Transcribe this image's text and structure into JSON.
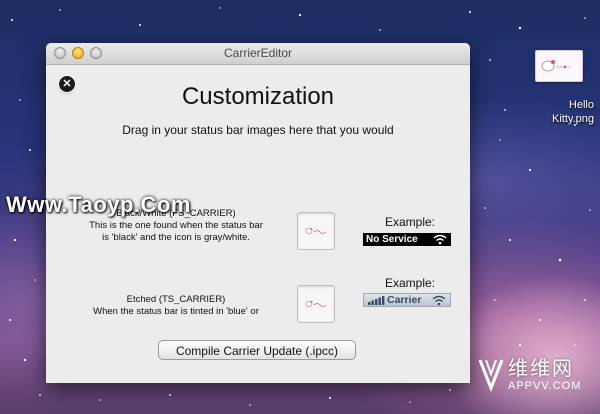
{
  "window": {
    "title": "CarrierEditor",
    "close_glyph": "✕"
  },
  "main": {
    "heading": "Customization",
    "instruction": "Drag in your status bar images here that you would",
    "sections": [
      {
        "desc_line1": "Black/White (FS_CARRIER)",
        "desc_line2": "This is the one found when the status bar",
        "desc_line3": "is 'black' and the icon is gray/white.",
        "example_label": "Example:",
        "example_text": "No Service"
      },
      {
        "desc_line1": "Etched (TS_CARRIER)",
        "desc_line2": "When the status bar is tinted in 'blue' or",
        "example_label": "Example:",
        "example_text": "Carrier"
      }
    ],
    "compile_button": "Compile Carrier Update (.ipcc)"
  },
  "desktop": {
    "file_label": "Hello\nKitty.png",
    "file_icon": "hello-kitty-image-thumbnail"
  },
  "overlays": {
    "watermark_text": "Www.Taoyp.Com",
    "brand_cn": "维维网",
    "brand_url": "APPVV.COM"
  },
  "colors": {
    "window_bg": "#ececec",
    "black_bar": "#000000",
    "blue_bar": "#c6cdd6"
  }
}
